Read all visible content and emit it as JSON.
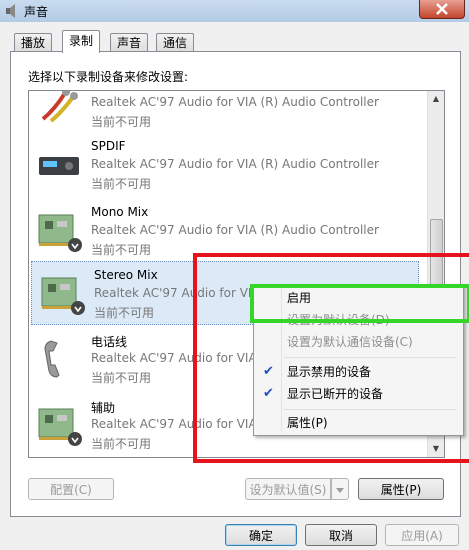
{
  "window": {
    "title": "声音"
  },
  "tabs": [
    {
      "label": "播放",
      "active": false
    },
    {
      "label": "录制",
      "active": true
    },
    {
      "label": "声音",
      "active": false
    },
    {
      "label": "通信",
      "active": false
    }
  ],
  "instruction": "选择以下录制设备来修改设置:",
  "devices": [
    {
      "name": "",
      "driver": "Realtek AC'97 Audio for VIA (R) Audio Controller",
      "state": "当前不可用",
      "icon": "rca-cable-icon"
    },
    {
      "name": "SPDIF",
      "driver": "Realtek AC'97 Audio for VIA (R) Audio Controller",
      "state": "当前不可用",
      "icon": "spdif-device-icon"
    },
    {
      "name": "Mono Mix",
      "driver": "Realtek AC'97 Audio for VIA (R) Audio Controller",
      "state": "当前不可用",
      "icon": "sound-card-icon"
    },
    {
      "name": "Stereo Mix",
      "driver": "Realtek AC'97 Audio for VIA",
      "state": "当前不可用",
      "icon": "sound-card-icon",
      "selected": true
    },
    {
      "name": "电话线",
      "driver": "Realtek AC'97 Audio for VIA",
      "state": "当前不可用",
      "icon": "telephone-icon"
    },
    {
      "name": "辅助",
      "driver": "Realtek AC'97 Audio for VIA",
      "state": "当前不可用",
      "icon": "sound-card-icon"
    }
  ],
  "context_menu": {
    "items": [
      {
        "label": "启用",
        "enabled": true,
        "checked": false
      },
      {
        "label": "设置为默认设备(D)",
        "enabled": false,
        "checked": false
      },
      {
        "label": "设置为默认通信设备(C)",
        "enabled": false,
        "checked": false
      },
      {
        "label": "显示禁用的设备",
        "enabled": true,
        "checked": true
      },
      {
        "label": "显示已断开的设备",
        "enabled": true,
        "checked": true
      },
      {
        "label": "属性(P)",
        "enabled": true,
        "checked": false
      }
    ]
  },
  "panel_buttons": {
    "configure": "配置(C)",
    "set_default": "设为默认值(S)",
    "properties": "属性(P)"
  },
  "dialog_buttons": {
    "ok": "确定",
    "cancel": "取消",
    "apply": "应用(A)"
  },
  "annotation_colors": {
    "red_box": "#e8121c",
    "green_box": "#35d62a"
  }
}
